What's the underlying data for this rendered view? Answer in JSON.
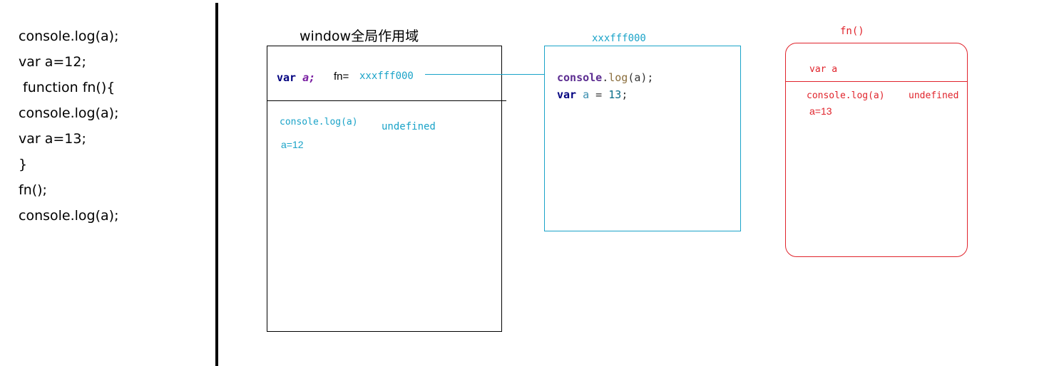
{
  "code_listing": [
    "console.log(a);",
    "var a=12;",
    " function fn(){",
    "console.log(a);",
    "var a=13;",
    "}",
    "fn();",
    "console.log(a);"
  ],
  "global_scope": {
    "title": "window全局作用域",
    "var_keyword": "var",
    "var_name": "a;",
    "fn_label": "fn=",
    "fn_address": "xxxfff000",
    "log_text": "console.log(a)",
    "log_result": "undefined",
    "assignment": "a=12"
  },
  "function_heap": {
    "address": "xxxfff000",
    "line1_obj": "console",
    "line1_dot": ".",
    "line1_method": "log",
    "line1_args": "(a);",
    "line2_kw": "var",
    "line2_name": "a",
    "line2_eq": " = ",
    "line2_val": "13",
    "line2_end": ";"
  },
  "fn_execution": {
    "title": "fn()",
    "declaration": "var a",
    "log_text": "console.log(a)",
    "log_result": "undefined",
    "assignment": "a=13"
  },
  "colors": {
    "global": "#000000",
    "heap": "#1aa3c8",
    "exec": "#e0232b"
  }
}
